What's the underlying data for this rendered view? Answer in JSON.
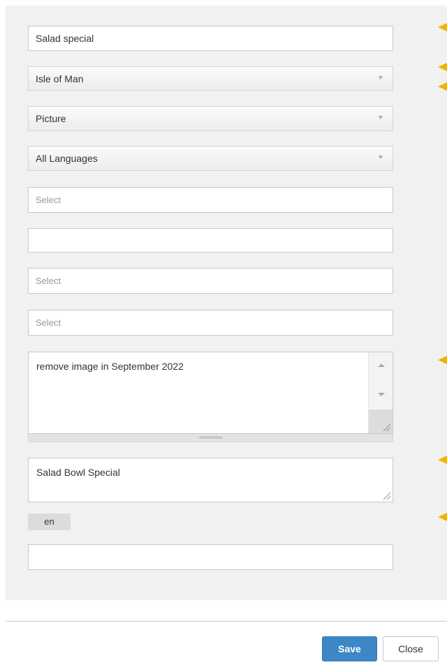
{
  "form": {
    "name_value": "Salad special",
    "country_value": "Isle of Man",
    "type_value": "Picture",
    "language_value": "All Languages",
    "select1_placeholder": "Select",
    "blank_field_value": "",
    "select2_placeholder": "Select",
    "select3_placeholder": "Select",
    "notes_value": "remove image in September 2022",
    "title_value": "Salad Bowl Special",
    "language_tag": "en",
    "last_field_value": ""
  },
  "footer": {
    "save_label": "Save",
    "close_label": "Close"
  },
  "colors": {
    "panel_bg": "#f1f1f1",
    "marker": "#f0b400",
    "save_button": "#3d87c7"
  },
  "icons": {
    "dropdown": "chevron-down-icon",
    "resize": "resize-grip-icon",
    "marker": "triangle-left-icon"
  }
}
